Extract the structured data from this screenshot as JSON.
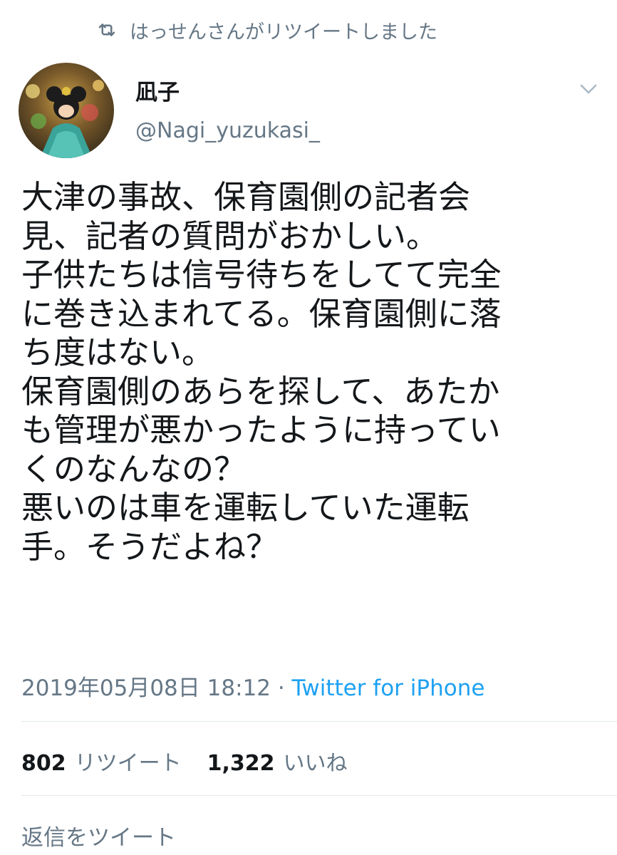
{
  "retweet_context": {
    "icon": "retweet-icon",
    "text": "はっせんさんがリツイートしました"
  },
  "author": {
    "display_name": "凪子",
    "handle": "@Nagi_yuzukasi_"
  },
  "tweet": {
    "lines": [
      "大津の事故、保育園側の記者会",
      "見、記者の質問がおかしい。",
      "子供たちは信号待ちをしてて完全",
      "に巻き込まれてる。保育園側に落",
      "ち度はない。",
      "保育園側のあらを探して、あたか",
      "も管理が悪かったように持ってい",
      "くのなんなの？",
      "悪いのは車を運転していた運転",
      "手。そうだよね？"
    ]
  },
  "meta": {
    "timestamp": "2019年05月08日 18:12",
    "separator": " · ",
    "source": "Twitter for iPhone"
  },
  "stats": {
    "retweet_count": "802",
    "retweet_label": "リツイート",
    "like_count": "1,322",
    "like_label": "いいね"
  },
  "reply": {
    "placeholder": "返信をツイート"
  },
  "colors": {
    "secondary_text": "#657786",
    "link": "#1da1f2",
    "divider": "#e1e8ed"
  }
}
